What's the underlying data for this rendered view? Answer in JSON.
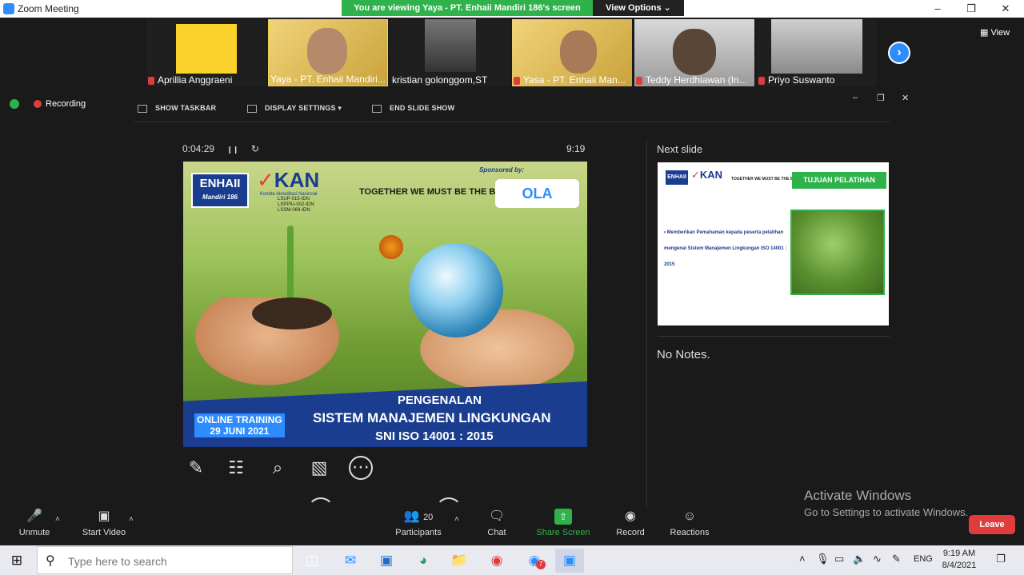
{
  "window": {
    "title": "Zoom Meeting",
    "banner": "You are viewing Yaya - PT. Enhaii Mandiri 186's screen",
    "view_options": "View Options ⌄",
    "minimize": "–",
    "restore": "❐",
    "close": "✕"
  },
  "gallery": {
    "view_label": "View",
    "participants": [
      {
        "name": "Aprillia Anggraeni",
        "muted": true
      },
      {
        "name": "Yaya - PT. Enhaii Mandiri...",
        "muted": false
      },
      {
        "name": "kristian golonggom,ST",
        "muted": false
      },
      {
        "name": "Yasa - PT. Enhaii Man...",
        "muted": true
      },
      {
        "name": "Teddy Herdhiawan (In...",
        "muted": true
      },
      {
        "name": "Priyo Suswanto",
        "muted": true
      }
    ],
    "next": "›"
  },
  "presenter": {
    "recording": "Recording",
    "show_taskbar": "SHOW TASKBAR",
    "display_settings": "DISPLAY SETTINGS ▾",
    "end_slide_show": "END SLIDE SHOW",
    "elapsed": "0:04:29",
    "pause": "❙❙",
    "restart": "↻",
    "clock": "9:19",
    "win_min": "–",
    "win_restore": "❐",
    "win_close": "✕"
  },
  "slide": {
    "enhaii": "ENHAII",
    "enhaii_sub": "Mandiri 186",
    "kan": "KAN",
    "kan_sub": "Komite Akreditasi Nasional",
    "accreditations": [
      "LSUP-015-IDN",
      "LSPPIU-002-IDN",
      "LSSM-069-IDN"
    ],
    "slogan": "TOGETHER WE MUST BE THE BEST",
    "sponsored": "Sponsored by:",
    "sponsor_logo": "OLA",
    "online_training": "ONLINE TRAINING",
    "date": "29 JUNI 2021",
    "title1": "PENGENALAN",
    "title2": "SISTEM MANAJEMEN LINGKUNGAN",
    "title3": "SNI ISO 14001 : 2015"
  },
  "annotate": {
    "pen": "✎",
    "layout": "☷",
    "zoom": "⌕",
    "pointer": "▧",
    "more": "⋯"
  },
  "side": {
    "next_slide_label": "Next slide",
    "notes": "No Notes.",
    "next": {
      "enhaii": "ENHAII",
      "kan": "KAN",
      "slogan": "TOGETHER WE MUST BE THE BEST",
      "heading": "TUJUAN PELATIHAN",
      "bullet": "• Memberikan Pemahaman kepada peserta pelatihan mengenai Sistem Manajemen Lingkungan ISO 14001 : 2015"
    }
  },
  "activation": {
    "title": "Activate Windows",
    "subtitle": "Go to Settings to activate Windows."
  },
  "controls": {
    "unmute": "Unmute",
    "start_video": "Start Video",
    "participants": "Participants",
    "participants_count": "20",
    "chat": "Chat",
    "share_screen": "Share Screen",
    "record": "Record",
    "reactions": "Reactions",
    "leave": "Leave",
    "caret": "˄"
  },
  "taskbar": {
    "start": "⊞",
    "search_placeholder": "Type here to search",
    "lang": "ENG",
    "time": "9:19 AM",
    "date": "8/4/2021",
    "notifications": "❐",
    "chrome_badge": "7",
    "tray_up": "˄",
    "mic": "🎙",
    "speaker": "🔈"
  },
  "colors": {
    "zoom_blue": "#2d8cff",
    "banner_green": "#2fb24b",
    "leave_red": "#e03c3c"
  }
}
